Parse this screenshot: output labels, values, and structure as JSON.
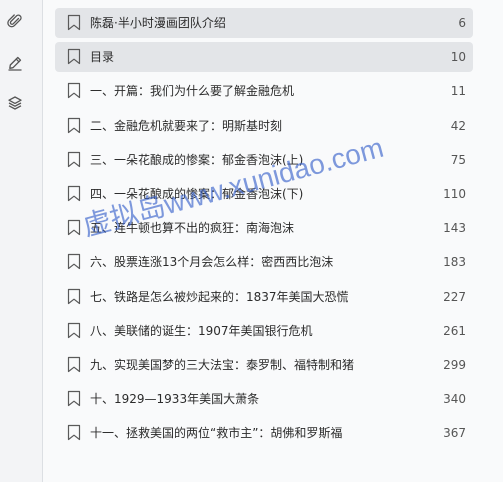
{
  "sidebar": {
    "icons": [
      "paperclip-icon",
      "pen-icon",
      "layers-icon"
    ]
  },
  "toc": {
    "items": [
      {
        "title": "陈磊·半小时漫画团队介绍",
        "page": "6"
      },
      {
        "title": "目录",
        "page": "10"
      },
      {
        "title": "一、开篇：我们为什么要了解金融危机",
        "page": "11"
      },
      {
        "title": "二、金融危机就要来了：明斯基时刻",
        "page": "42"
      },
      {
        "title": "三、一朵花酿成的惨案：郁金香泡沫(上)",
        "page": "75"
      },
      {
        "title": "四、一朵花酿成的惨案：郁金香泡沫(下)",
        "page": "110"
      },
      {
        "title": "五、连牛顿也算不出的疯狂：南海泡沫",
        "page": "143"
      },
      {
        "title": "六、股票连涨13个月会怎么样：密西西比泡沫",
        "page": "183"
      },
      {
        "title": "七、铁路是怎么被炒起来的：1837年美国大恐慌",
        "page": "227"
      },
      {
        "title": "八、美联储的诞生：1907年美国银行危机",
        "page": "261"
      },
      {
        "title": "九、实现美国梦的三大法宝：泰罗制、福特制和猪",
        "page": "299"
      },
      {
        "title": "十、1929—1933年美国大萧条",
        "page": "340"
      },
      {
        "title": "十一、拯救美国的两位“救市主”：胡佛和罗斯福",
        "page": "367"
      }
    ]
  },
  "watermark": {
    "text": "虚拟岛www.xunidao.com"
  }
}
